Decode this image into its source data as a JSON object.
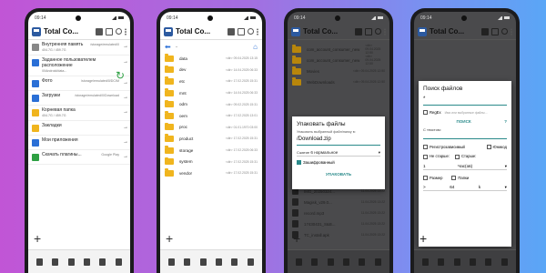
{
  "status_time": "09:14",
  "app_title": "Total Co...",
  "phone1": {
    "items": [
      {
        "name": "Внутренняя память",
        "sub": "404.7G / 459.7G",
        "path": "/storage/emulated/0",
        "icon": "phone-storage-icon",
        "color": "#888888"
      },
      {
        "name": "Заданное пользователем расположение",
        "sub": "/0/Android/data...",
        "path": "",
        "icon": "plus-icon",
        "color": "#2a6fd6"
      },
      {
        "name": "Фото",
        "sub": "",
        "path": "/storage/emulated/0/DCIM",
        "icon": "photo-icon",
        "color": "#2a6fd6"
      },
      {
        "name": "Загрузки",
        "sub": "",
        "path": "/storage/emulated/0/Download",
        "icon": "download-icon",
        "color": "#2a6fd6"
      },
      {
        "name": "Корневая папка",
        "sub": "404.7G / 459.7G",
        "path": "",
        "icon": "root-folder-icon",
        "color": "#f0b51e"
      },
      {
        "name": "Закладки",
        "sub": "",
        "path": "",
        "icon": "bookmark-icon",
        "color": "#f0b51e"
      },
      {
        "name": "Мои приложения",
        "sub": "",
        "path": "",
        "icon": "apps-icon",
        "color": "#2a6fd6"
      },
      {
        "name": "Скачать плагины...",
        "sub": "",
        "path": "Google Play",
        "icon": "plugins-icon",
        "color": "#2ea043"
      }
    ]
  },
  "phone2": {
    "nav_up": "..",
    "folders": [
      {
        "name": "data",
        "meta": "<dir>  09.04.2025 13:15"
      },
      {
        "name": "dev",
        "meta": "<dir>  14.04.2025 06:33"
      },
      {
        "name": "etc",
        "meta": "<dir>  17.02.2025 15:31"
      },
      {
        "name": "mnt",
        "meta": "<dir>  14.04.2025 06:33"
      },
      {
        "name": "odm",
        "meta": "<dir>  09.02.2025 15:31"
      },
      {
        "name": "oem",
        "meta": "<dir>  17.02.2025 13:01"
      },
      {
        "name": "proc",
        "meta": "<dir>  01.01.1970 03:00"
      },
      {
        "name": "product",
        "meta": "<dir>  17.02.2025 15:31"
      },
      {
        "name": "storage",
        "meta": "<dir>  17.02.2025 06:33"
      },
      {
        "name": "system",
        "meta": "<dir>  17.02.2025 15:31"
      },
      {
        "name": "vendor",
        "meta": "<dir>  17.02.2025 15:31"
      }
    ]
  },
  "phone3": {
    "bg_rows": [
      {
        "name": "com_account_consumer_new",
        "meta": "<dir>  09.04.2025 12:50"
      },
      {
        "name": "com_account_consumer_new",
        "meta": "<dir>  09.04.2025 12:50"
      },
      {
        "name": "Movies",
        "meta": "<dir>  09.04.2025 12:50"
      },
      {
        "name": "WebDownloads",
        "meta": "<dir>  09.04.2025 12:50"
      }
    ],
    "bottom_rows": [
      {
        "name": "IMG_20250324...",
        "meta": "11.04.2025 13:22"
      },
      {
        "name": "Magisk_v29.0...",
        "meta": "11.04.2025 13:22"
      },
      {
        "name": "record.mp3",
        "meta": "11.04.2025 13:22"
      },
      {
        "name": "17430431_S&B...",
        "meta": "11.04.2025 13:22"
      },
      {
        "name": "TC_install.apk",
        "meta": "11.04.2025 13:22"
      }
    ],
    "dialog": {
      "title": "Упаковать файлы",
      "text": "Упаковать выбранный файл/папку в:",
      "value": "/Download.zip",
      "level_label": "Сжатие",
      "level_value": "6 нормальное",
      "encrypt_label": "Зашифрованный",
      "button": "УПАКОВАТЬ"
    }
  },
  "phone4": {
    "dialog": {
      "title": "Поиск файлов",
      "field1": "*",
      "regex_label": "RegEx",
      "field1_hint": "Имя или выбранные файлы...",
      "search_button": "ПОИСК",
      "help_glyph": "?",
      "text_label": "С текстом:",
      "case_label": "Регистрозависимый",
      "unicode_label": "Юникод",
      "not_older_label": "Не старше:",
      "older_label": "Старше:",
      "age_value": "1",
      "age_unit": "Час(ов)",
      "size_label": "Размер",
      "folders_label": "Папки",
      "size_op": ">",
      "size_value": "64",
      "size_unit": "k"
    }
  }
}
